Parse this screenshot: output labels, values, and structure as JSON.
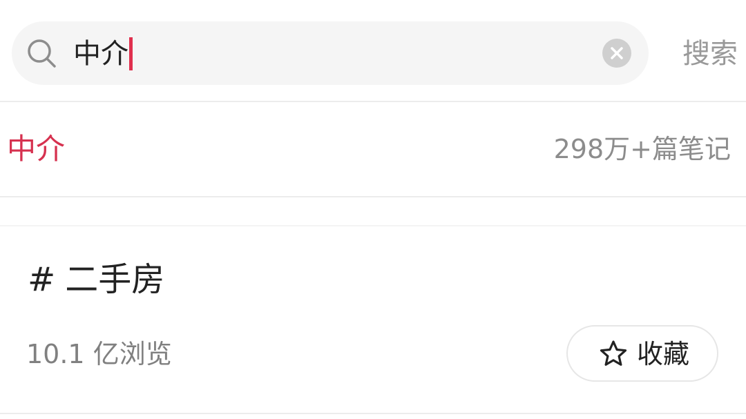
{
  "search": {
    "query": "中介",
    "button_label": "搜索",
    "icon": "search-icon",
    "clear_icon": "clear-icon",
    "caret_color": "#e0304e"
  },
  "suggestion": {
    "keyword": "中介",
    "count": "298万+篇笔记",
    "keyword_color": "#d6314f"
  },
  "topic": {
    "hash": "#",
    "title": "二手房",
    "views": "10.1 亿浏览",
    "collect_label": "收藏",
    "collect_icon": "star-icon"
  }
}
